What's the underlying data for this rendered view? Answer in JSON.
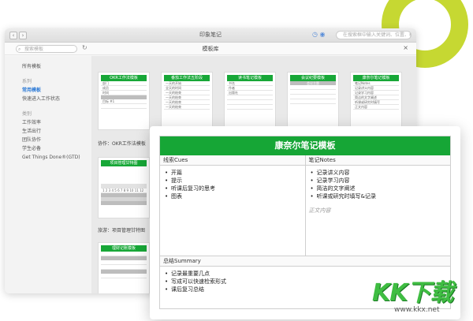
{
  "window": {
    "title": "印象笔记",
    "search_placeholder": "在搜索框中输入关键词、位置、标签",
    "nav_back": "‹",
    "nav_forward": "›"
  },
  "library": {
    "search_placeholder": "搜索模板",
    "title": "模板库",
    "close": "×"
  },
  "sidebar": {
    "items": [
      {
        "label": "所有模板",
        "kind": "item"
      },
      {
        "label": "系列",
        "kind": "section"
      },
      {
        "label": "常用模板",
        "kind": "item",
        "active": true
      },
      {
        "label": "快速进入工作状态",
        "kind": "item"
      },
      {
        "label": "类别",
        "kind": "section"
      },
      {
        "label": "工作效率",
        "kind": "item"
      },
      {
        "label": "生活出行",
        "kind": "item"
      },
      {
        "label": "团队协作",
        "kind": "item"
      },
      {
        "label": "学生必备",
        "kind": "item"
      },
      {
        "label": "Get Things Done®(GTD)",
        "kind": "item"
      }
    ]
  },
  "thumbnails": [
    {
      "title": "OKR工作法模板",
      "rows": [
        "部门",
        "成员",
        "时间",
        "",
        "目标 #1",
        ""
      ]
    },
    {
      "title": "番茄工作法五阶段",
      "rows": [
        "一天的开始",
        "全天的时间",
        "一天的结束",
        "一天的结束",
        "一天的结束",
        "一天的结束"
      ]
    },
    {
      "title": "读书笔记模板",
      "rows": [
        "书名",
        "作者",
        "出版社",
        "",
        "",
        ""
      ]
    },
    {
      "title": "会议纪要模板",
      "rows": [
        "会议主题",
        "",
        "",
        "",
        "",
        ""
      ]
    },
    {
      "title": "康奈尔笔记模板",
      "rows": [
        "笔记Notes",
        "记录讲义内容",
        "记录学习内容",
        "简洁的文字阐述",
        "听课或研究时填写",
        "正文内容"
      ]
    },
    {
      "title": "项目管理甘特图",
      "rows": []
    },
    {
      "title": "理财记账模板",
      "rows": []
    }
  ],
  "captions": {
    "okr": "协作：OKR工作法模板",
    "gantt": "旅游：项目管理甘特图"
  },
  "card": {
    "title": "康奈尔笔记模板",
    "cues_title": "线索Cues",
    "cues": [
      "开篇",
      "提示",
      "听课后复习的思考",
      "图表"
    ],
    "notes_title": "笔记Notes",
    "notes": [
      "记录讲义内容",
      "记录学习内容",
      "简洁的文字阐述",
      "听课或研究时填写&记录"
    ],
    "notes_placeholder": "正文内容",
    "summary_title": "总结Summary",
    "summary": [
      "记录最重要几点",
      "写成可以快速检索形式",
      "课后复习总结"
    ]
  },
  "watermark": {
    "logo": "KK下载",
    "url": "www.kkx.net"
  },
  "colors": {
    "accent_green": "#16a636",
    "lime": "#c6d832",
    "link_blue": "#2e7bd6"
  }
}
